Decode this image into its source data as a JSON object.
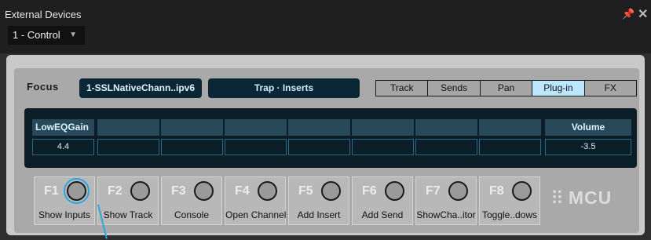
{
  "window": {
    "title": "External Devices",
    "pin_icon": "pin-icon",
    "close_icon": "close-icon",
    "device_select": {
      "value": "1 - Control",
      "caret_icon": "chevron-down-icon"
    }
  },
  "focus": {
    "label": "Focus",
    "plugin_name": "1-SSLNativeChann..ipv6",
    "bank_name": "Trap · Inserts"
  },
  "modes": {
    "tabs": [
      "Track",
      "Sends",
      "Pan",
      "Plug-in",
      "FX"
    ],
    "active": "Plug-in"
  },
  "display": {
    "channels": [
      {
        "name": "LowEQGain",
        "value": "4.4"
      },
      {
        "name": "",
        "value": ""
      },
      {
        "name": "",
        "value": ""
      },
      {
        "name": "",
        "value": ""
      },
      {
        "name": "",
        "value": ""
      },
      {
        "name": "",
        "value": ""
      },
      {
        "name": "",
        "value": ""
      },
      {
        "name": "",
        "value": ""
      }
    ],
    "volume": {
      "name": "Volume",
      "value": "-3.5"
    }
  },
  "function_keys": [
    {
      "key": "F1",
      "label": "Show Inputs"
    },
    {
      "key": "F2",
      "label": "Show Track"
    },
    {
      "key": "F3",
      "label": "Console"
    },
    {
      "key": "F4",
      "label": "Open Channel"
    },
    {
      "key": "F5",
      "label": "Add Insert"
    },
    {
      "key": "F6",
      "label": "Add Send"
    },
    {
      "key": "F7",
      "label": "ShowCha..itor"
    },
    {
      "key": "F8",
      "label": "Toggle..dows"
    }
  ],
  "selected_key": "F1",
  "logo": {
    "text": "MCU",
    "icon": "waveform-logo-icon"
  },
  "colors": {
    "accent": "#2aa6e0",
    "active_tab": "#bde6ff",
    "display_bg": "#0b1e28"
  }
}
